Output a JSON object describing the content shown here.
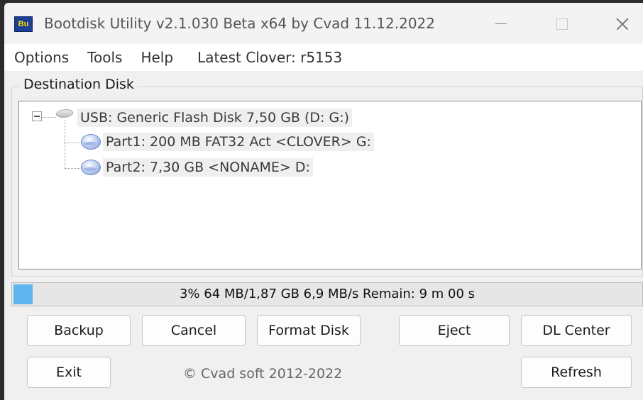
{
  "window": {
    "app_icon_text": "Bu",
    "title": "Bootdisk Utility v2.1.030 Beta x64 by Cvad 11.12.2022"
  },
  "menu": {
    "items": [
      "Options",
      "Tools",
      "Help"
    ],
    "latest_clover": "Latest Clover: r5153"
  },
  "destination": {
    "group_title": "Destination Disk",
    "disk": {
      "label": "USB: Generic Flash Disk 7,50 GB (D: G:)",
      "icon": "usb-drive-icon",
      "partitions": [
        {
          "label": "Part1: 200 MB FAT32 Act <CLOVER> G:",
          "icon": "partition-disk-icon"
        },
        {
          "label": "Part2: 7,30 GB <NONAME> D:",
          "icon": "partition-disk-icon"
        }
      ]
    }
  },
  "progress": {
    "percent": 3,
    "text": "3% 64 MB/1,87 GB 6,9 MB/s  Remain: 9 m 00 s",
    "color": "#5fb5f0"
  },
  "buttons": {
    "backup": "Backup",
    "cancel": "Cancel",
    "format_disk": "Format Disk",
    "eject": "Eject",
    "dl_center": "DL Center",
    "exit": "Exit",
    "refresh": "Refresh"
  },
  "footer": {
    "copyright": "© Cvad soft 2012-2022"
  }
}
